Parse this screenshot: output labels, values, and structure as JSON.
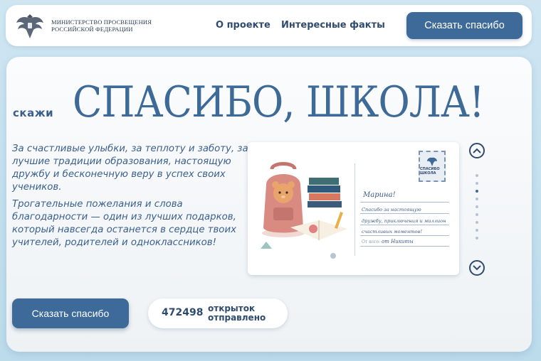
{
  "header": {
    "logo_line1": "МИНИСТЕРСТВО ПРОСВЕЩЕНИЯ",
    "logo_line2": "РОССИЙСКОЙ ФЕДЕРАЦИИ",
    "nav": [
      {
        "label": "О проекте"
      },
      {
        "label": "Интересные факты"
      }
    ],
    "cta_label": "Сказать спасибо"
  },
  "hero": {
    "say": "скажи",
    "headline": "СПАСИБО, ШКОЛА!",
    "paragraph1": "За счастливые улыбки, за теплоту и заботу, за лучшие традиции образования, настоящую дружбу и бесконечную веру в успех своих учеников.",
    "paragraph2": "Трогательные пожелания и слова благодарности — один из лучших подарков, который навсегда останется в сердце твоих учителей, родителей и одноклассников!",
    "cta_label": "Сказать спасибо"
  },
  "postcard": {
    "recipient": "Марина!",
    "message_line1": "Спасибо за настоящую",
    "message_line2": "дружбу, приключения и миллион",
    "message_line3": "счастливых моментов!",
    "from_label": "От кого:",
    "sender": "от Никиты",
    "stamp_text": "СПАСИБО ШКОЛА"
  },
  "slider": {
    "dot_count": 9,
    "active_index": 2
  },
  "counter": {
    "value": "472498",
    "label_line1": "открыток",
    "label_line2": "отправлено"
  },
  "colors": {
    "accent": "#3d6a99",
    "text": "#3a5f8c",
    "background": "#c6e1ef"
  },
  "icons": {
    "logo": "double-headed-eagle-emblem",
    "up": "chevron-up-icon",
    "down": "chevron-down-icon"
  }
}
